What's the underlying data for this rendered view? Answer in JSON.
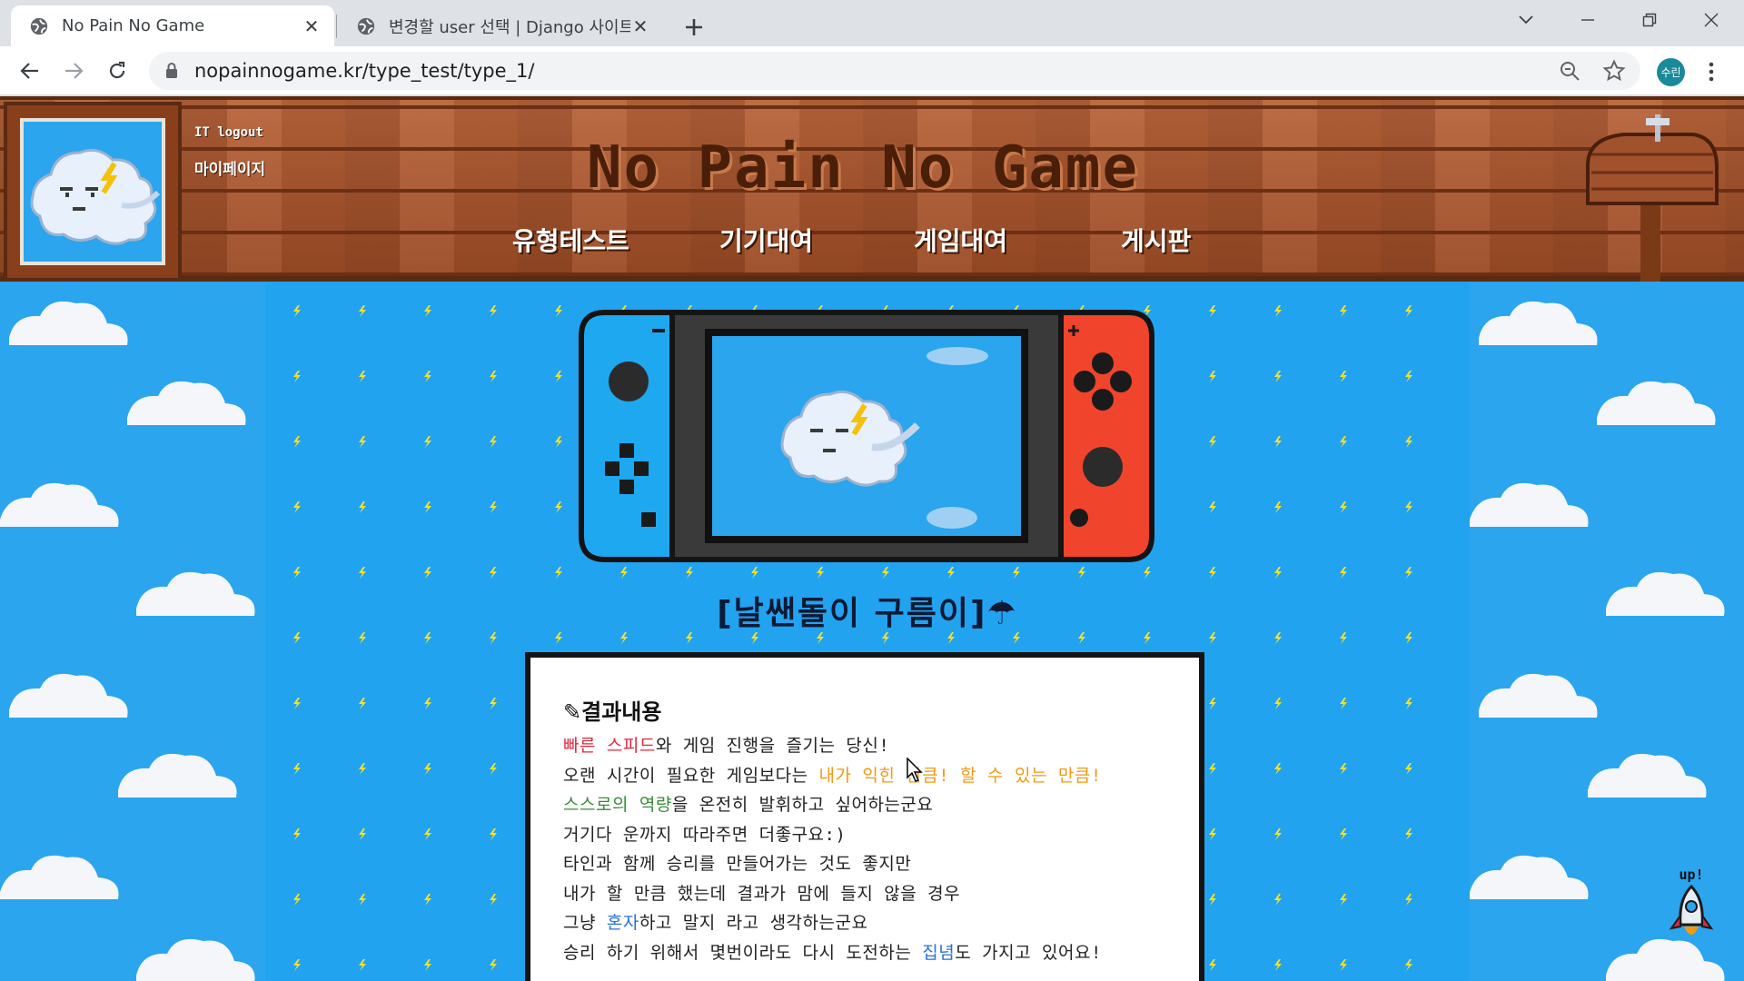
{
  "browser": {
    "tabs": [
      {
        "title": "No Pain No Game",
        "active": true
      },
      {
        "title": "변경할 user 선택 | Django 사이트",
        "active": false
      }
    ],
    "url": "nopainnogame.kr/type_test/type_1/",
    "profile_label": "수린"
  },
  "header": {
    "user_link": "IT logout",
    "mypage_link": "마이페이지",
    "site_title": "No Pain No Game",
    "nav": [
      "유형테스트",
      "기기대여",
      "게임대여",
      "게시판"
    ]
  },
  "result": {
    "title": "[날쌘돌이 구름이]☂",
    "heading": "결과내용",
    "lines": [
      [
        {
          "t": "빠른 스피드",
          "c": "red"
        },
        {
          "t": "와 게임 진행을 즐기는 당신!",
          "c": ""
        }
      ],
      [
        {
          "t": "오랜 시간이 필요한 게임보다는 ",
          "c": ""
        },
        {
          "t": "내가 익힌 만큼! 할 수 있는 만큼!",
          "c": "orange"
        }
      ],
      [
        {
          "t": "스스로의 역량",
          "c": "green"
        },
        {
          "t": "을 온전히 발휘하고 싶어하는군요",
          "c": ""
        }
      ],
      [
        {
          "t": "거기다 운까지 따라주면 더좋구요:)",
          "c": ""
        }
      ],
      [
        {
          "t": "타인과 함께 승리를 만들어가는 것도 좋지만",
          "c": ""
        }
      ],
      [
        {
          "t": "내가 할 만큼 했는데 결과가 맘에 들지 않을 경우",
          "c": ""
        }
      ],
      [
        {
          "t": "그냥 ",
          "c": ""
        },
        {
          "t": "혼자",
          "c": "blue"
        },
        {
          "t": "하고 말지 라고 생각하는군요",
          "c": ""
        }
      ],
      [
        {
          "t": "승리 하기 위해서 몇번이라도 다시 도전하는 ",
          "c": ""
        },
        {
          "t": "집념",
          "c": "blue"
        },
        {
          "t": "도 가지고 있어요!",
          "c": ""
        }
      ]
    ]
  },
  "up_button_label": "up!",
  "colors": {
    "sky": "#2aa5ee",
    "wood": "#a0522d",
    "joycon_left": "#1ea8f0",
    "joycon_right": "#f0442c"
  }
}
